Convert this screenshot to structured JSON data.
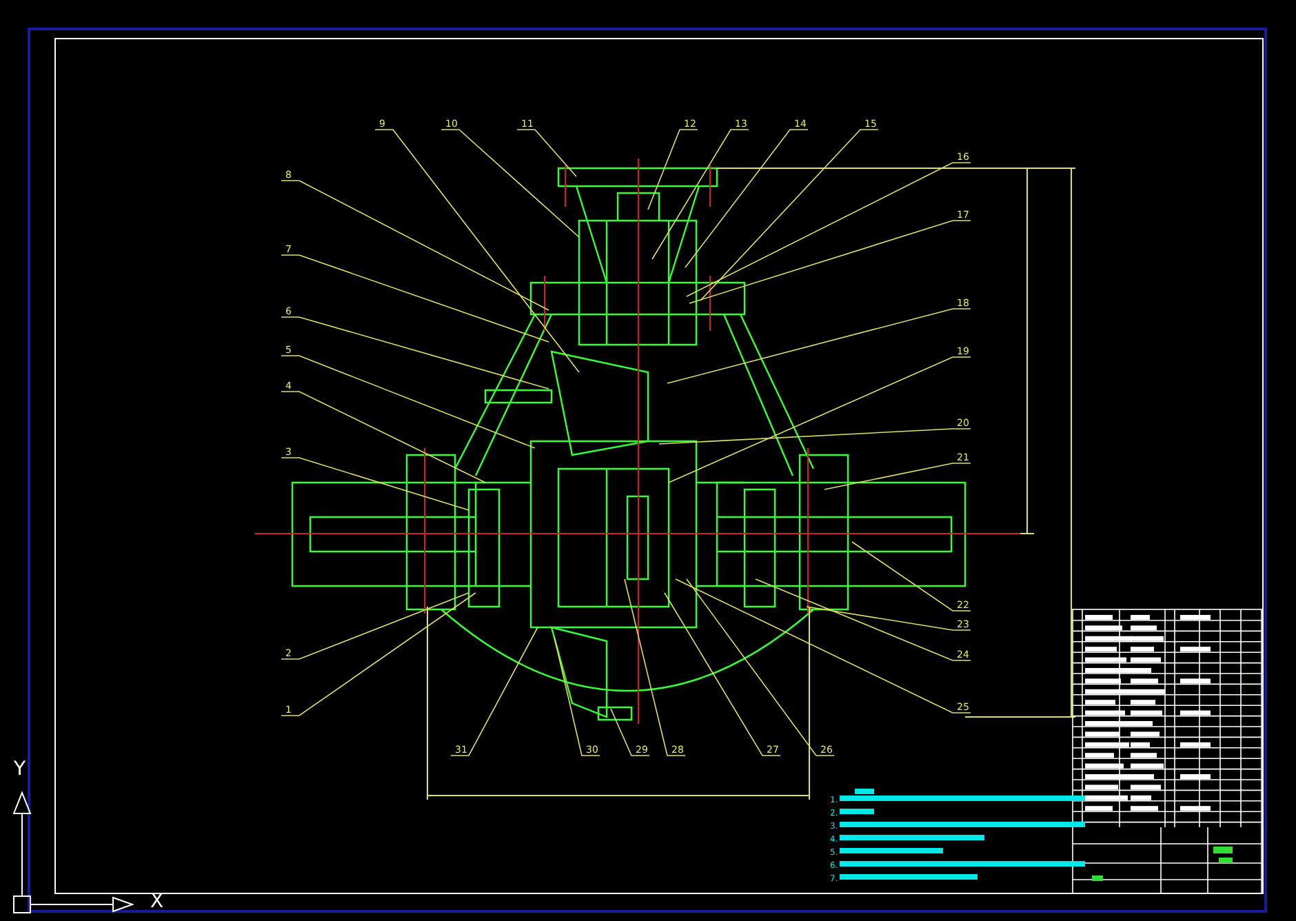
{
  "drawing": {
    "balloons": [
      {
        "label": "9"
      },
      {
        "label": "10"
      },
      {
        "label": "11"
      },
      {
        "label": "12"
      },
      {
        "label": "13"
      },
      {
        "label": "14"
      },
      {
        "label": "15"
      },
      {
        "label": "16"
      },
      {
        "label": "17"
      },
      {
        "label": "8"
      },
      {
        "label": "7"
      },
      {
        "label": "6"
      },
      {
        "label": "5"
      },
      {
        "label": "4"
      },
      {
        "label": "3"
      },
      {
        "label": "18"
      },
      {
        "label": "19"
      },
      {
        "label": "20"
      },
      {
        "label": "21"
      },
      {
        "label": "2"
      },
      {
        "label": "1"
      },
      {
        "label": "22"
      },
      {
        "label": "23"
      },
      {
        "label": "24"
      },
      {
        "label": "25"
      },
      {
        "label": "31"
      },
      {
        "label": "30"
      },
      {
        "label": "29"
      },
      {
        "label": "28"
      },
      {
        "label": "27"
      },
      {
        "label": "26"
      }
    ]
  },
  "notes": {
    "items": [
      {
        "number": "1."
      },
      {
        "number": "2."
      },
      {
        "number": "3."
      },
      {
        "number": "4."
      },
      {
        "number": "5."
      },
      {
        "number": "6."
      },
      {
        "number": "7."
      }
    ]
  },
  "ucs": {
    "x_label": "X",
    "y_label": "Y"
  }
}
